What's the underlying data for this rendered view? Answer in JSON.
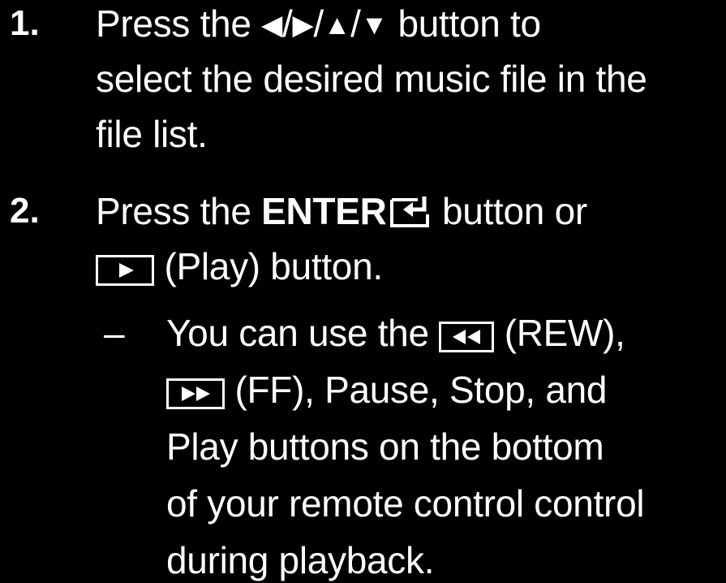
{
  "steps": [
    {
      "number": "1.",
      "line1_a": "Press the",
      "arrows": {
        "left": "◀",
        "right": "▶",
        "up": "▲",
        "down": "▼",
        "sep": "/"
      },
      "line1_b": "button to",
      "line2": "select the desired music file in the",
      "line3": "file list."
    },
    {
      "number": "2.",
      "line1_a": "Press the",
      "enter_label": "ENTER",
      "line1_b": "button or",
      "line2": "(Play) button.",
      "note": {
        "dash": "–",
        "line1_a": "You can use the",
        "line1_b": "(REW),",
        "line2": "(FF), Pause, Stop, and",
        "line3": "Play buttons on the bottom",
        "line4": "of your remote control control",
        "line5": "during playback."
      }
    }
  ],
  "icons": {
    "enter": "enter-icon",
    "play": "play-icon",
    "rew": "rewind-icon",
    "ff": "fast-forward-icon"
  }
}
